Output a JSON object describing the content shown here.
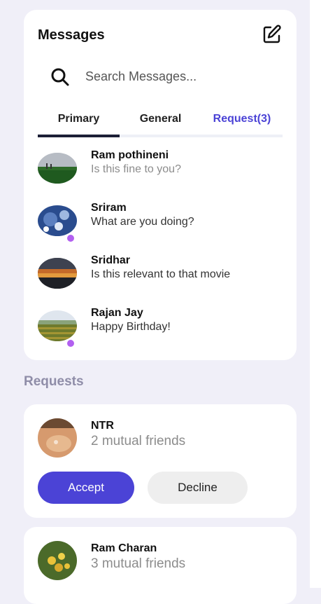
{
  "messages_panel": {
    "title": "Messages",
    "search_placeholder": "Search Messages...",
    "tabs": [
      {
        "label": "Primary",
        "active": true
      },
      {
        "label": "General",
        "active": false
      },
      {
        "label": "Request(3)",
        "active": false
      }
    ],
    "items": [
      {
        "name": "Ram pothineni",
        "text": "Is this fine to you?",
        "unread": false
      },
      {
        "name": "Sriram",
        "text": "What are you doing?",
        "unread": true
      },
      {
        "name": "Sridhar",
        "text": "Is this relevant to that movie",
        "unread": false
      },
      {
        "name": "Rajan Jay",
        "text": "Happy Birthday!",
        "unread": true
      }
    ]
  },
  "requests": {
    "title": "Requests",
    "items": [
      {
        "name": "NTR",
        "mutual": "2 mutual friends",
        "accept_label": "Accept",
        "decline_label": "Decline"
      },
      {
        "name": "Ram Charan",
        "mutual": "3 mutual friends"
      }
    ]
  },
  "colors": {
    "accent": "#4b43d6",
    "online_dot": "#b260f0",
    "background": "#f0eff8"
  }
}
